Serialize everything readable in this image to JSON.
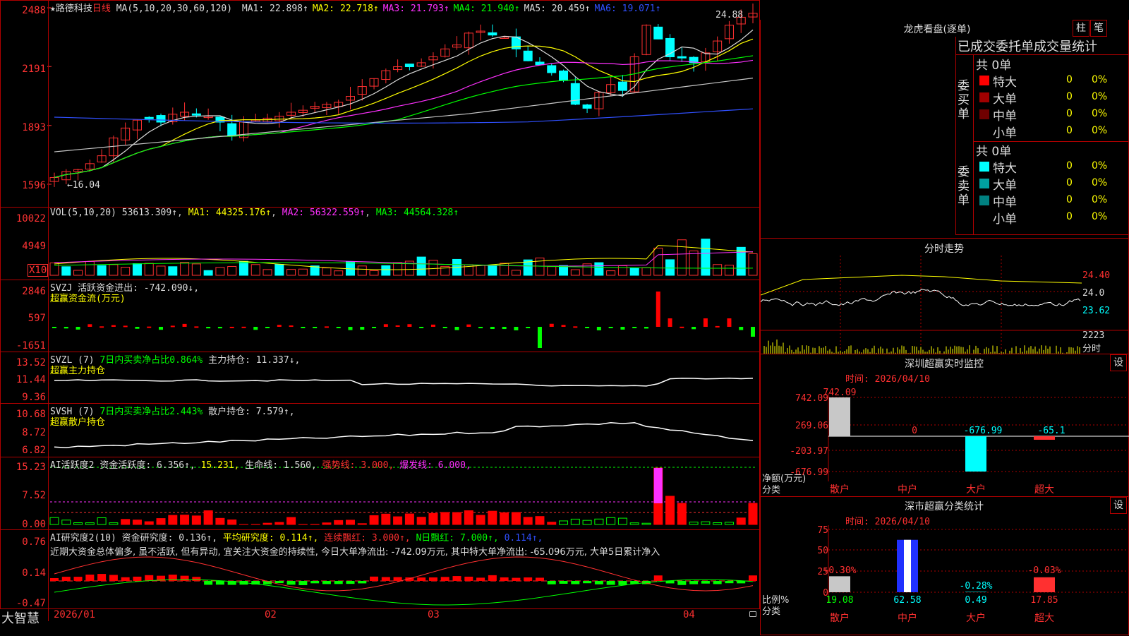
{
  "header": {
    "star": "★",
    "stock_name": "路德科技",
    "period": "日线",
    "ma_params": "MA(5,10,20,30,60,120)",
    "ma": [
      {
        "label": "MA1: 22.898↑",
        "color": "#dcdcdc"
      },
      {
        "label": "MA2: 22.718↑",
        "color": "#ffff00"
      },
      {
        "label": "MA3: 21.793↑",
        "color": "#ff30ff"
      },
      {
        "label": "MA4: 21.940↑",
        "color": "#00ff00"
      },
      {
        "label": "MA5: 20.459↑",
        "color": "#dcdcdc"
      },
      {
        "label": "MA6: 19.071↑",
        "color": "#3050ff"
      }
    ]
  },
  "price_panel": {
    "y_labels": [
      "2488",
      "2191",
      "1893",
      "1596"
    ],
    "high_label": "24.88",
    "low_label": "16.04"
  },
  "vol_panel": {
    "title": "VOL(5,10,20)",
    "value": "53613.309↑",
    "ma1": "MA1: 44325.176↑",
    "ma2": "MA2: 56322.559↑",
    "ma3": "MA3: 44564.328↑",
    "y_labels": [
      "10022",
      "4949"
    ],
    "unit": "X10"
  },
  "svzj_panel": {
    "name": "SVZJ",
    "text": "活跃资金进出: -742.090↓,",
    "subtitle": "超赢资金流(万元)",
    "y_labels": [
      "2846",
      "597",
      "-1651"
    ]
  },
  "svzl_panel": {
    "name": "SVZL (7)",
    "text1": "7日内买卖净占比0.864%",
    "text2": "主力持仓: 11.337↓,",
    "subtitle": "超赢主力持仓",
    "y_labels": [
      "13.52",
      "11.44",
      "9.36"
    ]
  },
  "svsh_panel": {
    "name": "SVSH (7)",
    "text1": "7日内买卖净占比2.443%",
    "text2": "散户持仓: 7.579↑,",
    "subtitle": "超赢散户持仓",
    "y_labels": [
      "10.68",
      "8.72",
      "6.82"
    ]
  },
  "ai1_panel": {
    "name": "AI活跃度2",
    "t1": "资金活跃度: 6.356↑,",
    "t2": "15.231,",
    "t3": "生命线: 1.560,",
    "t4": "强势线: 3.000,",
    "t5": "爆发线: 6.000,",
    "y_labels": [
      "15.23",
      "7.52",
      "0.00"
    ]
  },
  "ai2_panel": {
    "name": "AI研究度2(10)",
    "t1": "资金研究度: 0.136↑,",
    "t2": "平均研究度: 0.114↑,",
    "t3": "连续飘红: 3.000↑,",
    "t4": "N日飘红: 7.000↑,",
    "t5": "0.114↑,",
    "comment": "近期大资金总体偏多, 虽不活跃, 但有异动, 宜关注大资金的持续性, 今日大单净流出: -742.09万元, 其中特大单净流出: -65.096万元, 大单5日累计净入",
    "y_labels": [
      "0.76",
      "0.14",
      "-0.47"
    ]
  },
  "x_axis": {
    "logo": "大智慧",
    "labels": [
      "2026/01",
      "02",
      "03",
      "04"
    ]
  },
  "right": {
    "lhb_title": "龙虎看盘(逐单)",
    "btn1": "柱",
    "btn2": "笔",
    "tabs": "已成交委托单成交量统计",
    "buy_side": {
      "label": "委买单",
      "total": "共 0单",
      "rows": [
        {
          "name": "特大",
          "val": "0",
          "pct": "0%",
          "color": "#ff0000"
        },
        {
          "name": "大单",
          "val": "0",
          "pct": "0%",
          "color": "#a00000"
        },
        {
          "name": "中单",
          "val": "0",
          "pct": "0%",
          "color": "#700000"
        },
        {
          "name": "小单",
          "val": "0",
          "pct": "0%",
          "color": ""
        }
      ]
    },
    "sell_side": {
      "label": "委卖单",
      "total": "共 0单",
      "rows": [
        {
          "name": "特大",
          "val": "0",
          "pct": "0%",
          "color": "#00ffff"
        },
        {
          "name": "大单",
          "val": "0",
          "pct": "0%",
          "color": "#00a0a0"
        },
        {
          "name": "中单",
          "val": "0",
          "pct": "0%",
          "color": "#008080"
        },
        {
          "name": "小单",
          "val": "0",
          "pct": "0%",
          "color": ""
        }
      ]
    },
    "fs_title": "分时走势",
    "fs_prices": [
      "24.40",
      "24.0",
      "23.62"
    ],
    "fs_vol": [
      "2223",
      "分时"
    ],
    "sz_title": "深圳超赢实时监控",
    "sz_btn": "设",
    "sz_time": "时间: 2026/04/10",
    "sz_y": [
      "742.09",
      "269.06",
      "-203.97",
      "-676.99"
    ],
    "sz_vals": [
      "742.09",
      "0",
      "-676.99",
      "-65.1"
    ],
    "sz_ylabel1": "净额(万元)",
    "sz_ylabel2": "分类",
    "sz_cats": [
      "散户",
      "中户",
      "大户",
      "超大"
    ],
    "ss_title": "深市超赢分类统计",
    "ss_btn": "设",
    "ss_time": "时间: 2026/04/10",
    "ss_y": [
      "75",
      "50",
      "25",
      "0"
    ],
    "ss_top": [
      "+0.30%",
      "",
      "-0.28%",
      "-0.03%"
    ],
    "ss_vals": [
      "19.08",
      "62.58",
      "0.49",
      "17.85"
    ],
    "ss_ylabel1": "比例%",
    "ss_ylabel2": "分类",
    "ss_cats": [
      "散户",
      "中户",
      "大户",
      "超大"
    ]
  }
}
